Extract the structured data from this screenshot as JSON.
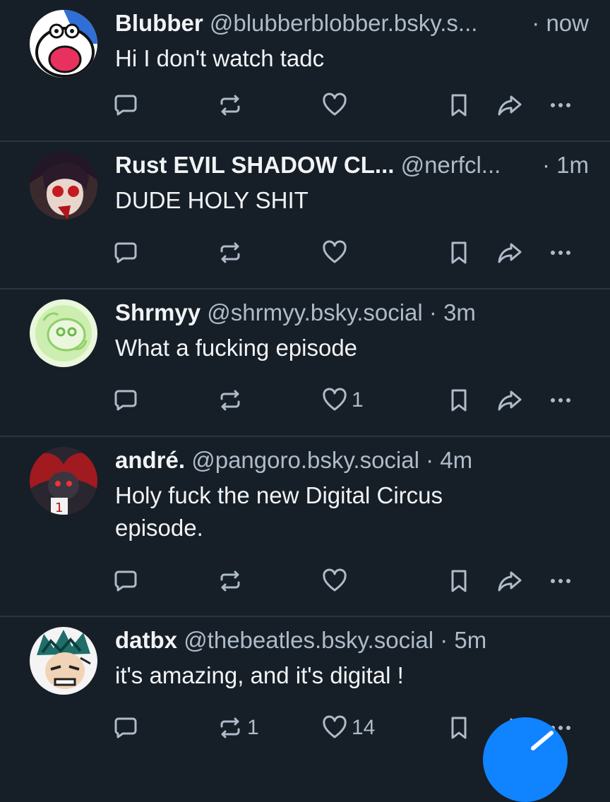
{
  "posts": [
    {
      "name": "Blubber",
      "handle": "@blubberblobber.bsky.s...",
      "time": "· now",
      "text": "Hi I don't watch tadc",
      "reply_count": "",
      "repost_count": "",
      "like_count": ""
    },
    {
      "name": "Rust EVIL SHADOW CL...",
      "handle": "@nerfcl...",
      "time": "· 1m",
      "text": "DUDE HOLY SHIT",
      "reply_count": "",
      "repost_count": "",
      "like_count": ""
    },
    {
      "name": "Shrmyy",
      "handle": "@shrmyy.bsky.social",
      "time": "· 3m",
      "text": "What a fucking episode",
      "reply_count": "",
      "repost_count": "",
      "like_count": "1"
    },
    {
      "name": "andré.",
      "handle": "@pangoro.bsky.social",
      "time": "· 4m",
      "text": "Holy fuck the new Digital Circus episode.",
      "reply_count": "",
      "repost_count": "",
      "like_count": ""
    },
    {
      "name": "datbx",
      "handle": "@thebeatles.bsky.social",
      "time": "· 5m",
      "text": "it's amazing, and it's digital !",
      "reply_count": "",
      "repost_count": "1",
      "like_count": "14"
    }
  ],
  "icons": {
    "reply": "speech-bubble-icon",
    "repost": "repost-arrows-icon",
    "like": "heart-icon",
    "save": "bookmark-icon",
    "share": "share-arrow-icon",
    "more": "ellipsis-icon",
    "compose": "compose-pencil-icon"
  },
  "colors": {
    "background": "#161e27",
    "divider": "#2a3541",
    "text_primary": "#f1f3f5",
    "text_secondary": "#aebbc9",
    "accent": "#1083fe"
  }
}
